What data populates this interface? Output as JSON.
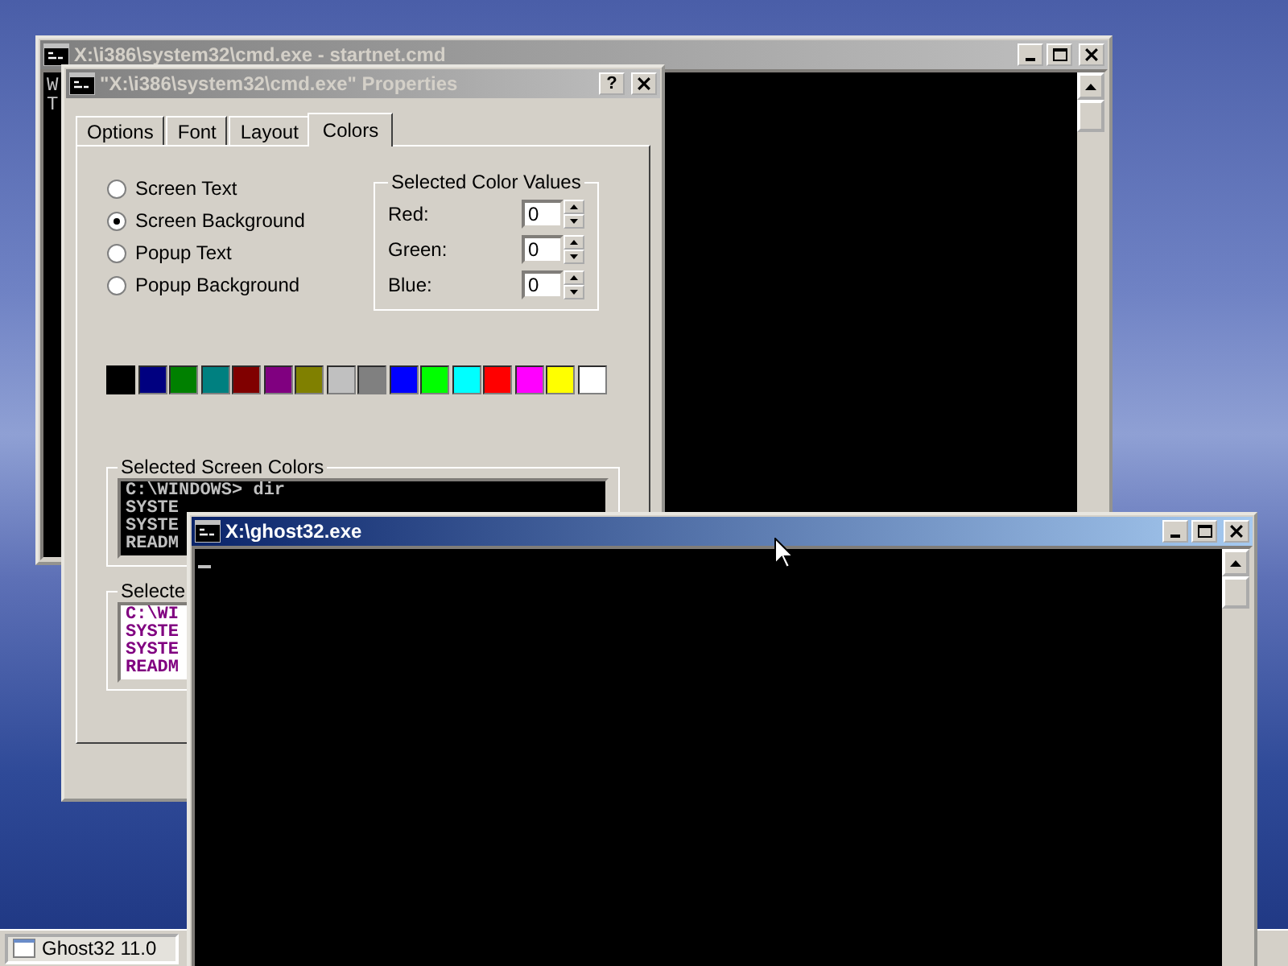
{
  "console_window": {
    "title": "X:\\i386\\system32\\cmd.exe - startnet.cmd",
    "active": false,
    "lines": [
      "W",
      "T"
    ]
  },
  "properties_dialog": {
    "title": "\"X:\\i386\\system32\\cmd.exe\" Properties",
    "active": false,
    "help_button": "?",
    "tabs": [
      {
        "label": "Options",
        "selected": false
      },
      {
        "label": "Font",
        "selected": false
      },
      {
        "label": "Layout",
        "selected": false
      },
      {
        "label": "Colors",
        "selected": true
      }
    ],
    "color_targets": [
      {
        "label": "Screen Text",
        "selected": false
      },
      {
        "label": "Screen Background",
        "selected": true
      },
      {
        "label": "Popup Text",
        "selected": false
      },
      {
        "label": "Popup Background",
        "selected": false
      }
    ],
    "color_values": {
      "title": "Selected Color Values",
      "fields": [
        {
          "label": "Red:",
          "value": "0"
        },
        {
          "label": "Green:",
          "value": "0"
        },
        {
          "label": "Blue:",
          "value": "0"
        }
      ]
    },
    "palette": [
      {
        "color": "#000000",
        "selected": true
      },
      {
        "color": "#000080",
        "selected": false
      },
      {
        "color": "#008000",
        "selected": false
      },
      {
        "color": "#008080",
        "selected": false
      },
      {
        "color": "#800000",
        "selected": false
      },
      {
        "color": "#800080",
        "selected": false
      },
      {
        "color": "#808000",
        "selected": false
      },
      {
        "color": "#c0c0c0",
        "selected": false
      },
      {
        "color": "#808080",
        "selected": false
      },
      {
        "color": "#0000ff",
        "selected": false
      },
      {
        "color": "#00ff00",
        "selected": false
      },
      {
        "color": "#00ffff",
        "selected": false
      },
      {
        "color": "#ff0000",
        "selected": false
      },
      {
        "color": "#ff00ff",
        "selected": false
      },
      {
        "color": "#ffff00",
        "selected": false
      },
      {
        "color": "#ffffff",
        "selected": false
      }
    ],
    "previews": [
      {
        "title": "Selected Screen Colors",
        "kind": "screen",
        "lines": [
          "C:\\WINDOWS> dir",
          "SYSTE",
          "SYSTE",
          "READM"
        ]
      },
      {
        "title": "Selecte",
        "kind": "popup",
        "lines": [
          "C:\\WI",
          "SYSTE",
          "SYSTE",
          "READM"
        ]
      }
    ]
  },
  "ghost_window": {
    "title": "X:\\ghost32.exe",
    "active": true
  },
  "taskbar": {
    "buttons": [
      {
        "label": "Ghost32 11.0"
      }
    ]
  }
}
